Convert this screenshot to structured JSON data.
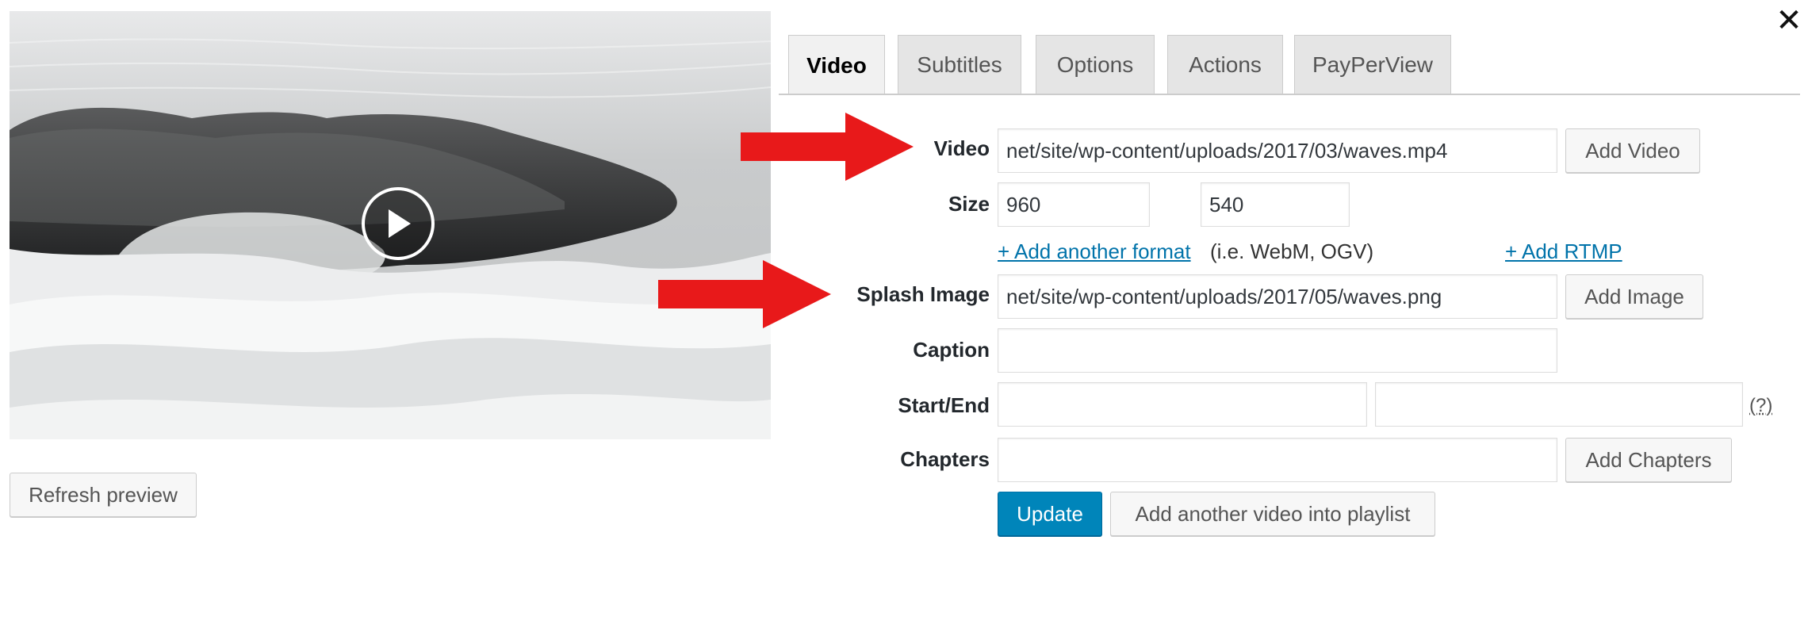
{
  "close": {
    "glyph": "✕"
  },
  "preview": {
    "refresh_label": "Refresh preview"
  },
  "tabs": [
    {
      "label": "Video",
      "active": true
    },
    {
      "label": "Subtitles",
      "active": false
    },
    {
      "label": "Options",
      "active": false
    },
    {
      "label": "Actions",
      "active": false
    },
    {
      "label": "PayPerView",
      "active": false
    }
  ],
  "form": {
    "video": {
      "label": "Video",
      "value": "net/site/wp-content/uploads/2017/03/waves.mp4",
      "button": "Add Video"
    },
    "size": {
      "label": "Size",
      "width": "960",
      "height": "540"
    },
    "links": {
      "add_format": "+ Add another format",
      "add_format_note": "(i.e. WebM, OGV)",
      "add_rtmp": "+ Add RTMP"
    },
    "splash": {
      "label": "Splash Image",
      "value": "net/site/wp-content/uploads/2017/05/waves.png",
      "button": "Add Image"
    },
    "caption": {
      "label": "Caption",
      "value": ""
    },
    "start_end": {
      "label": "Start/End",
      "start": "",
      "end": "",
      "help": "(?)"
    },
    "chapters": {
      "label": "Chapters",
      "value": "",
      "button": "Add Chapters"
    },
    "actions": {
      "update": "Update",
      "add_playlist": "Add another video into playlist"
    }
  },
  "colors": {
    "arrow": "#e8191a",
    "primary": "#0085ba",
    "link": "#0073aa"
  }
}
